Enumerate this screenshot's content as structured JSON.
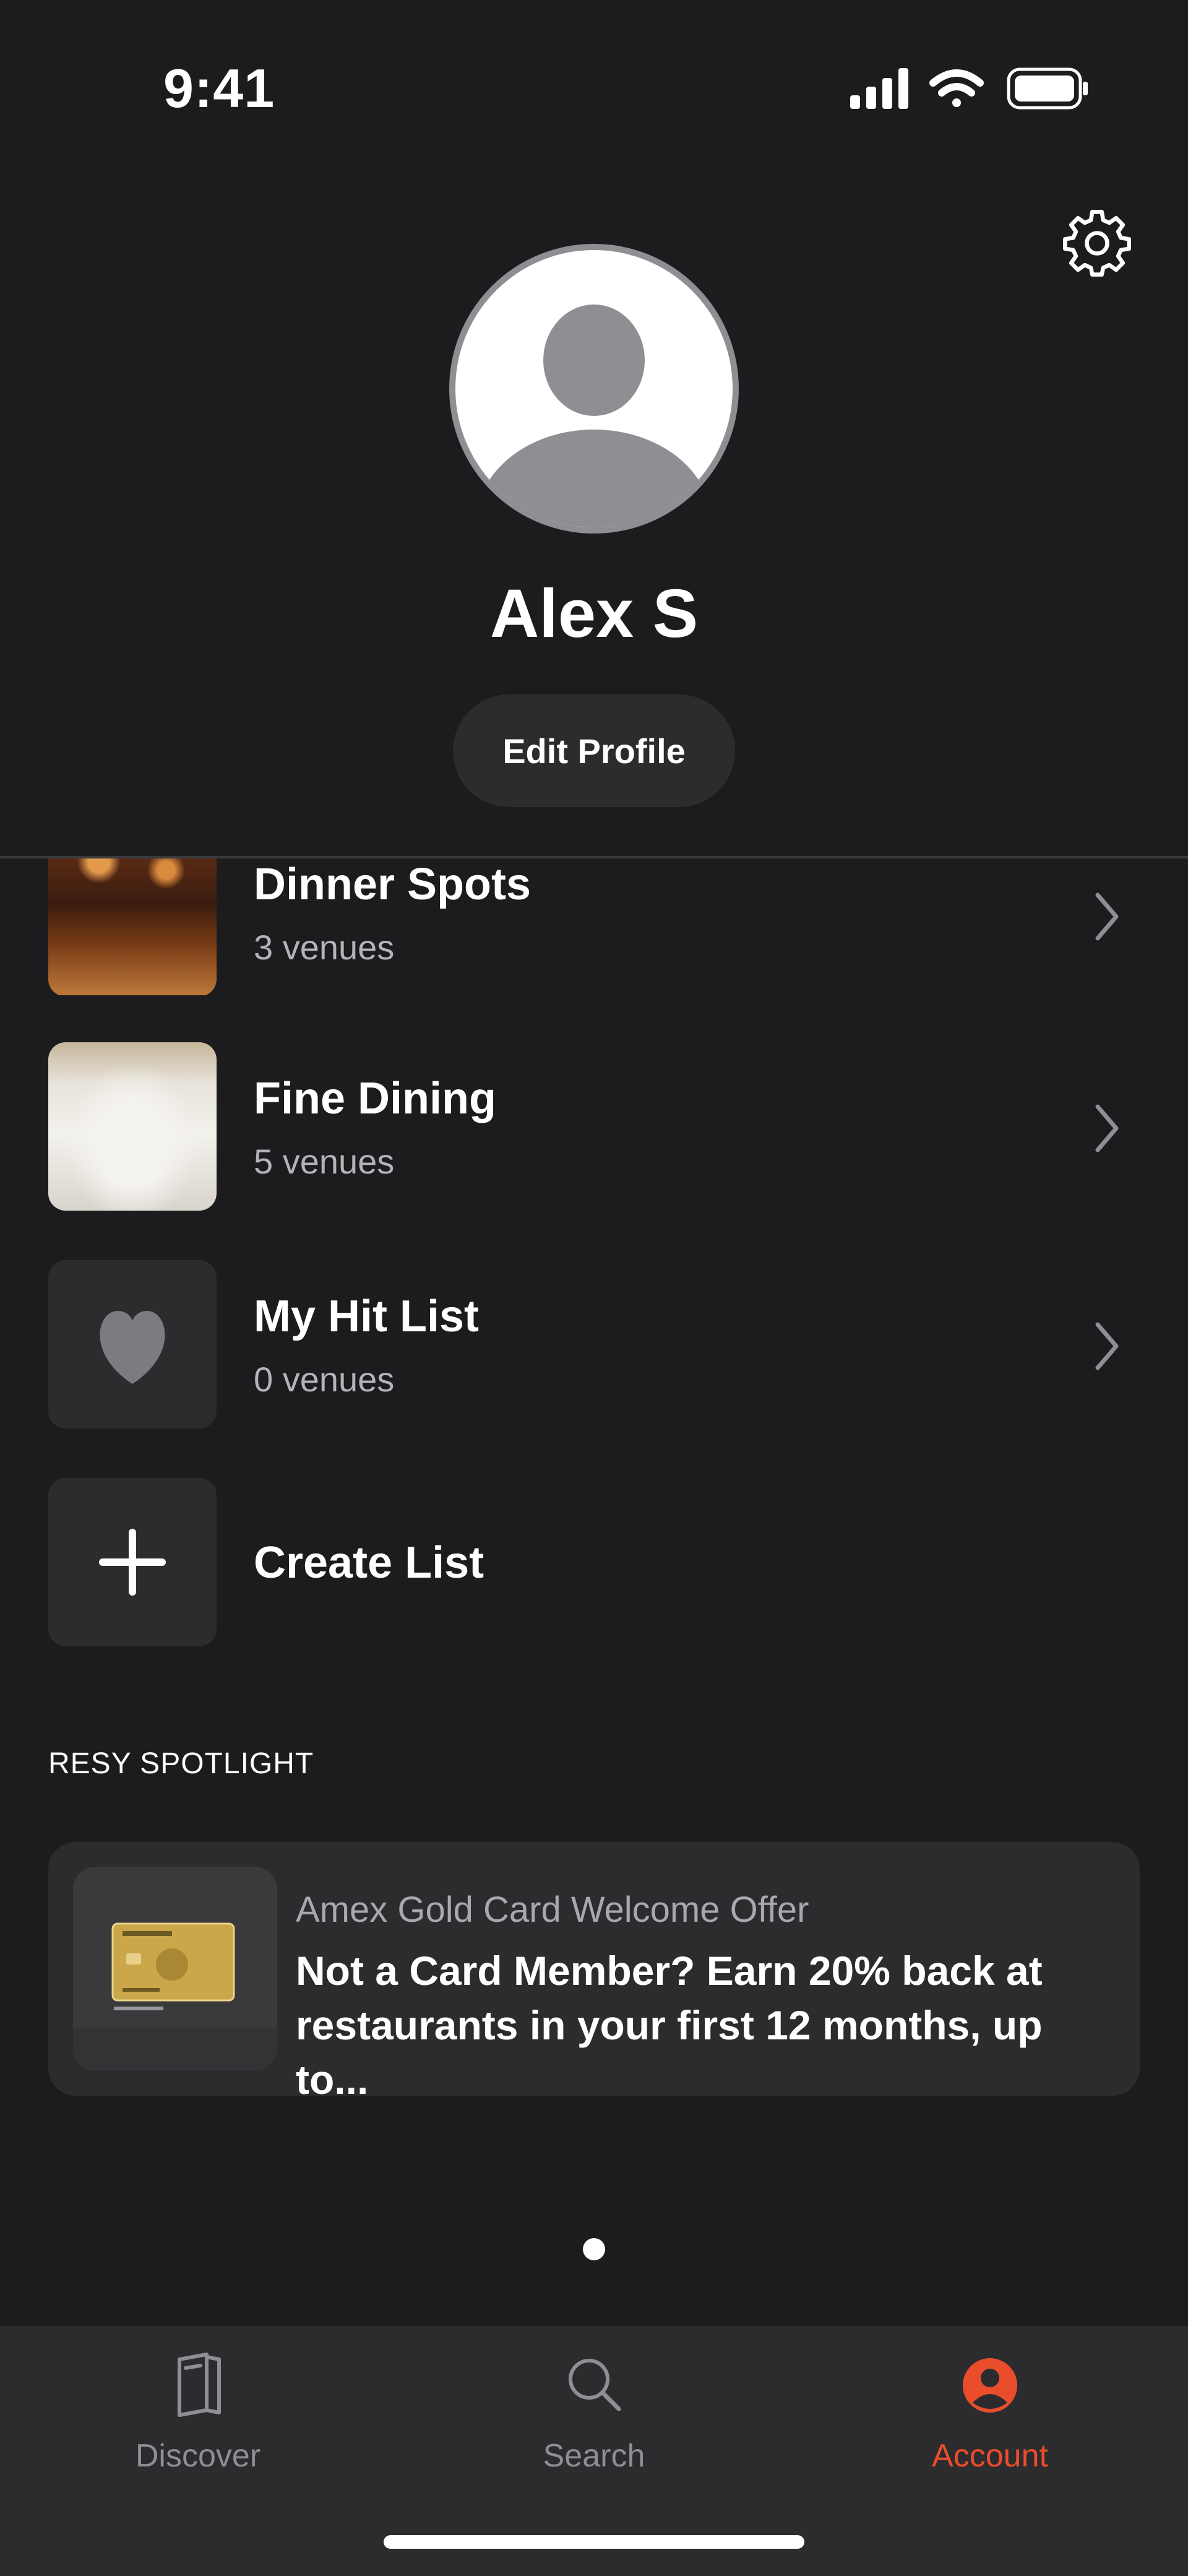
{
  "status_bar": {
    "time": "9:41"
  },
  "profile": {
    "name": "Alex S",
    "edit_label": "Edit Profile"
  },
  "lists": [
    {
      "title": "Dinner Spots",
      "subtitle": "3 venues"
    },
    {
      "title": "Fine Dining",
      "subtitle": "5 venues"
    },
    {
      "title": "My Hit List",
      "subtitle": "0 venues"
    }
  ],
  "create_list_label": "Create List",
  "spotlight": {
    "heading": "RESY SPOTLIGHT",
    "card_label": "Amex Gold Card Welcome Offer",
    "card_title": "Not a Card Member? Earn 20% back at restaurants in your first 12 months, up to..."
  },
  "tabs": [
    {
      "label": "Discover",
      "icon": "book-icon"
    },
    {
      "label": "Search",
      "icon": "search-icon"
    },
    {
      "label": "Account",
      "icon": "account-icon",
      "active": true
    }
  ],
  "colors": {
    "background": "#1c1c1e",
    "accent": "#ea4d2c",
    "card": "#2c2c2e"
  }
}
